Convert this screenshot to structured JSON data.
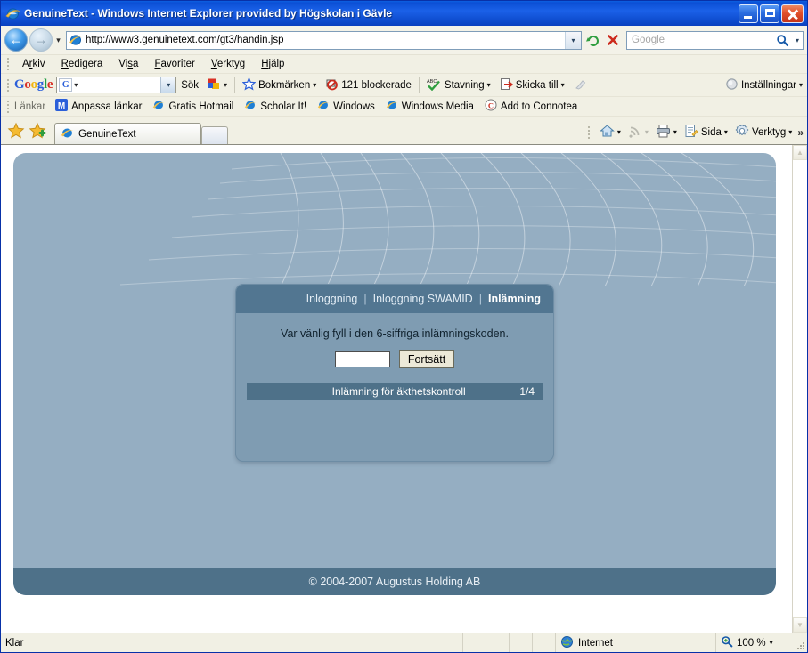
{
  "window": {
    "title": "GenuineText - Windows Internet Explorer provided by Högskolan i Gävle",
    "minimize_label": "Minimera",
    "maximize_label": "Maximera",
    "close_label": "Stäng"
  },
  "nav": {
    "back_label": "Tillbaka",
    "forward_label": "Framåt",
    "history_caret": "▾",
    "url": "http://www3.genuinetext.com/gt3/handin.jsp",
    "url_caret": "▾",
    "refresh_label": "Uppdatera",
    "stop_label": "Stoppa",
    "search_placeholder": "Google",
    "search_caret": "▾"
  },
  "menu": {
    "items": [
      {
        "pre": "A",
        "key": "r",
        "post": "kiv"
      },
      {
        "pre": "",
        "key": "R",
        "post": "edigera"
      },
      {
        "pre": "Vi",
        "key": "s",
        "post": "a"
      },
      {
        "pre": "",
        "key": "F",
        "post": "avoriter"
      },
      {
        "pre": "",
        "key": "V",
        "post": "erktyg"
      },
      {
        "pre": "",
        "key": "H",
        "post": "jälp"
      }
    ]
  },
  "google_toolbar": {
    "logo": [
      "G",
      "o",
      "o",
      "g",
      "l",
      "e"
    ],
    "search_value": "",
    "search_icon_letter": "G",
    "search_caret": "▾",
    "search_button": "Sök",
    "highlight_caret": "▾",
    "bookmarks_label": "Bokmärken",
    "bookmarks_caret": "▾",
    "blocked_label": "121 blockerade",
    "spell_label": "Stavning",
    "spell_caret": "▾",
    "send_label": "Skicka till",
    "send_caret": "▾",
    "settings_label": "Inställningar",
    "settings_caret": "▾"
  },
  "links_bar": {
    "label": "Länkar",
    "items": [
      {
        "label": "Anpassa länkar",
        "icon": "msn-icon"
      },
      {
        "label": "Gratis Hotmail",
        "icon": "ie-icon"
      },
      {
        "label": "Scholar It!",
        "icon": "ie-icon"
      },
      {
        "label": "Windows",
        "icon": "ie-icon"
      },
      {
        "label": "Windows Media",
        "icon": "ie-icon"
      },
      {
        "label": "Add to Connotea",
        "icon": "connotea-icon"
      }
    ]
  },
  "tabs": {
    "favorites_label": "Favoriter",
    "add_favorite_label": "Lägg till på Favoriter",
    "open": [
      {
        "label": "GenuineText",
        "active": true
      }
    ],
    "new_tab_label": "Ny flik",
    "tools": [
      {
        "label": "",
        "icon": "home-icon",
        "caret": "▾"
      },
      {
        "label": "",
        "icon": "rss-icon",
        "caret": "▾"
      },
      {
        "label": "",
        "icon": "print-icon",
        "caret": "▾"
      },
      {
        "label": "Sida",
        "icon": "page-icon",
        "caret": "▾"
      },
      {
        "label": "Verktyg",
        "icon": "gear-icon",
        "caret": "▾"
      }
    ],
    "overflow": "»"
  },
  "site": {
    "panel": {
      "nav": [
        {
          "label": "Inloggning",
          "active": false
        },
        {
          "label": "Inloggning SWAMID",
          "active": false
        },
        {
          "label": "Inlämning",
          "active": true
        }
      ],
      "separator": "|",
      "prompt": "Var vänlig fyll i den 6-siffriga inlämningskoden.",
      "code_value": "",
      "code_placeholder": "",
      "submit_label": "Fortsätt",
      "progress_title": "Inlämning för äkthetskontroll",
      "progress_count": "1/4"
    },
    "footer": "© 2004-2007 Augustus Holding AB"
  },
  "statusbar": {
    "status": "Klar",
    "zone": "Internet",
    "zoom": "100 %",
    "zoom_caret": "▾"
  },
  "colors": {
    "titlebar_blue": "#0b4fd6",
    "chrome_beige": "#f1f0e4",
    "site_bg": "#95aec2",
    "panel_bg": "#7f9cb2",
    "panel_header": "#527691",
    "panel_accent": "#4e7189",
    "button_face": "#ece9d8"
  }
}
